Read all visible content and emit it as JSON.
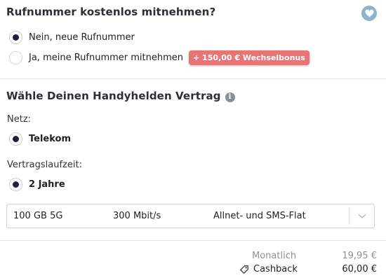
{
  "number_port": {
    "title": "Rufnummer kostenlos mitnehmen?",
    "options": [
      {
        "label": "Nein, neue Rufnummer",
        "checked": true
      },
      {
        "label": "Ja, meine Rufnummer mitnehmen",
        "checked": false
      }
    ],
    "bonus_badge": "+ 150,00 € Wechselbonus"
  },
  "favorite": {
    "icon": "heart-icon"
  },
  "contract": {
    "title": "Wähle Deinen Handyhelden Vertrag",
    "info_icon": "info-icon",
    "network_label": "Netz:",
    "network_option": "Telekom",
    "term_label": "Vertragslaufzeit:",
    "term_option": "2 Jahre",
    "tariff": {
      "data": "100 GB 5G",
      "speed": "300 Mbit/s",
      "flat": "Allnet- und SMS-Flat"
    }
  },
  "pricing": {
    "monthly_label": "Monatlich",
    "monthly_value": "19,95 €",
    "cashback_label": "Cashback",
    "cashback_value": "60,00 €",
    "cashback_icon": "tag-icon"
  },
  "colors": {
    "badge": "#e87575",
    "radio_dot": "#1d2240",
    "heart_bg": "#8fb3cf"
  }
}
